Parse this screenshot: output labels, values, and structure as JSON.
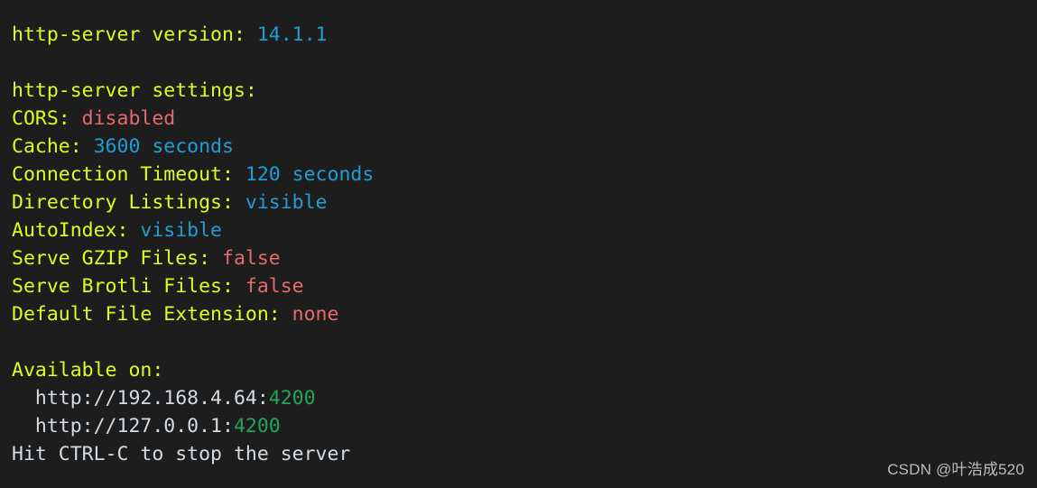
{
  "terminal": {
    "background_color": "#1d1d1d",
    "colors": {
      "label": "#ddfc20",
      "value_cyan": "#1f9ed6",
      "value_red": "#e46a6b",
      "port_green": "#23a559",
      "url_white": "#d3dbe3",
      "watermark": "#b9bcc0"
    },
    "lines": [
      {
        "id": "version-line",
        "tokens": [
          {
            "text": "http-server version: ",
            "color": "label"
          },
          {
            "text": "14.1.1",
            "color": "value_cyan"
          }
        ]
      },
      {
        "id": "blank-1",
        "tokens": []
      },
      {
        "id": "settings-header",
        "tokens": [
          {
            "text": "http-server settings:",
            "color": "label"
          }
        ]
      },
      {
        "id": "setting-cors",
        "tokens": [
          {
            "text": "CORS: ",
            "color": "label"
          },
          {
            "text": "disabled",
            "color": "value_red"
          }
        ]
      },
      {
        "id": "setting-cache",
        "tokens": [
          {
            "text": "Cache: ",
            "color": "label"
          },
          {
            "text": "3600 seconds",
            "color": "value_cyan"
          }
        ]
      },
      {
        "id": "setting-connection-timeout",
        "tokens": [
          {
            "text": "Connection Timeout: ",
            "color": "label"
          },
          {
            "text": "120 seconds",
            "color": "value_cyan"
          }
        ]
      },
      {
        "id": "setting-directory-listings",
        "tokens": [
          {
            "text": "Directory Listings: ",
            "color": "label"
          },
          {
            "text": "visible",
            "color": "value_cyan"
          }
        ]
      },
      {
        "id": "setting-autoindex",
        "tokens": [
          {
            "text": "AutoIndex: ",
            "color": "label"
          },
          {
            "text": "visible",
            "color": "value_cyan"
          }
        ]
      },
      {
        "id": "setting-serve-gzip",
        "tokens": [
          {
            "text": "Serve GZIP Files: ",
            "color": "label"
          },
          {
            "text": "false",
            "color": "value_red"
          }
        ]
      },
      {
        "id": "setting-serve-brotli",
        "tokens": [
          {
            "text": "Serve Brotli Files: ",
            "color": "label"
          },
          {
            "text": "false",
            "color": "value_red"
          }
        ]
      },
      {
        "id": "setting-default-file-extension",
        "tokens": [
          {
            "text": "Default File Extension: ",
            "color": "label"
          },
          {
            "text": "none",
            "color": "value_red"
          }
        ]
      },
      {
        "id": "blank-2",
        "tokens": []
      },
      {
        "id": "available-header",
        "tokens": [
          {
            "text": "Available on:",
            "color": "label"
          }
        ]
      },
      {
        "id": "available-url-lan",
        "tokens": [
          {
            "text": "  http://192.168.4.64:",
            "color": "url_white"
          },
          {
            "text": "4200",
            "color": "port_green"
          }
        ]
      },
      {
        "id": "available-url-localhost",
        "tokens": [
          {
            "text": "  http://127.0.0.1:",
            "color": "url_white"
          },
          {
            "text": "4200",
            "color": "port_green"
          }
        ]
      },
      {
        "id": "hit-ctrl-c-hint",
        "tokens": [
          {
            "text": "Hit CTRL-C to stop the server",
            "color": "url_white"
          }
        ]
      }
    ]
  },
  "watermark": {
    "text": "CSDN @叶浩成520"
  }
}
